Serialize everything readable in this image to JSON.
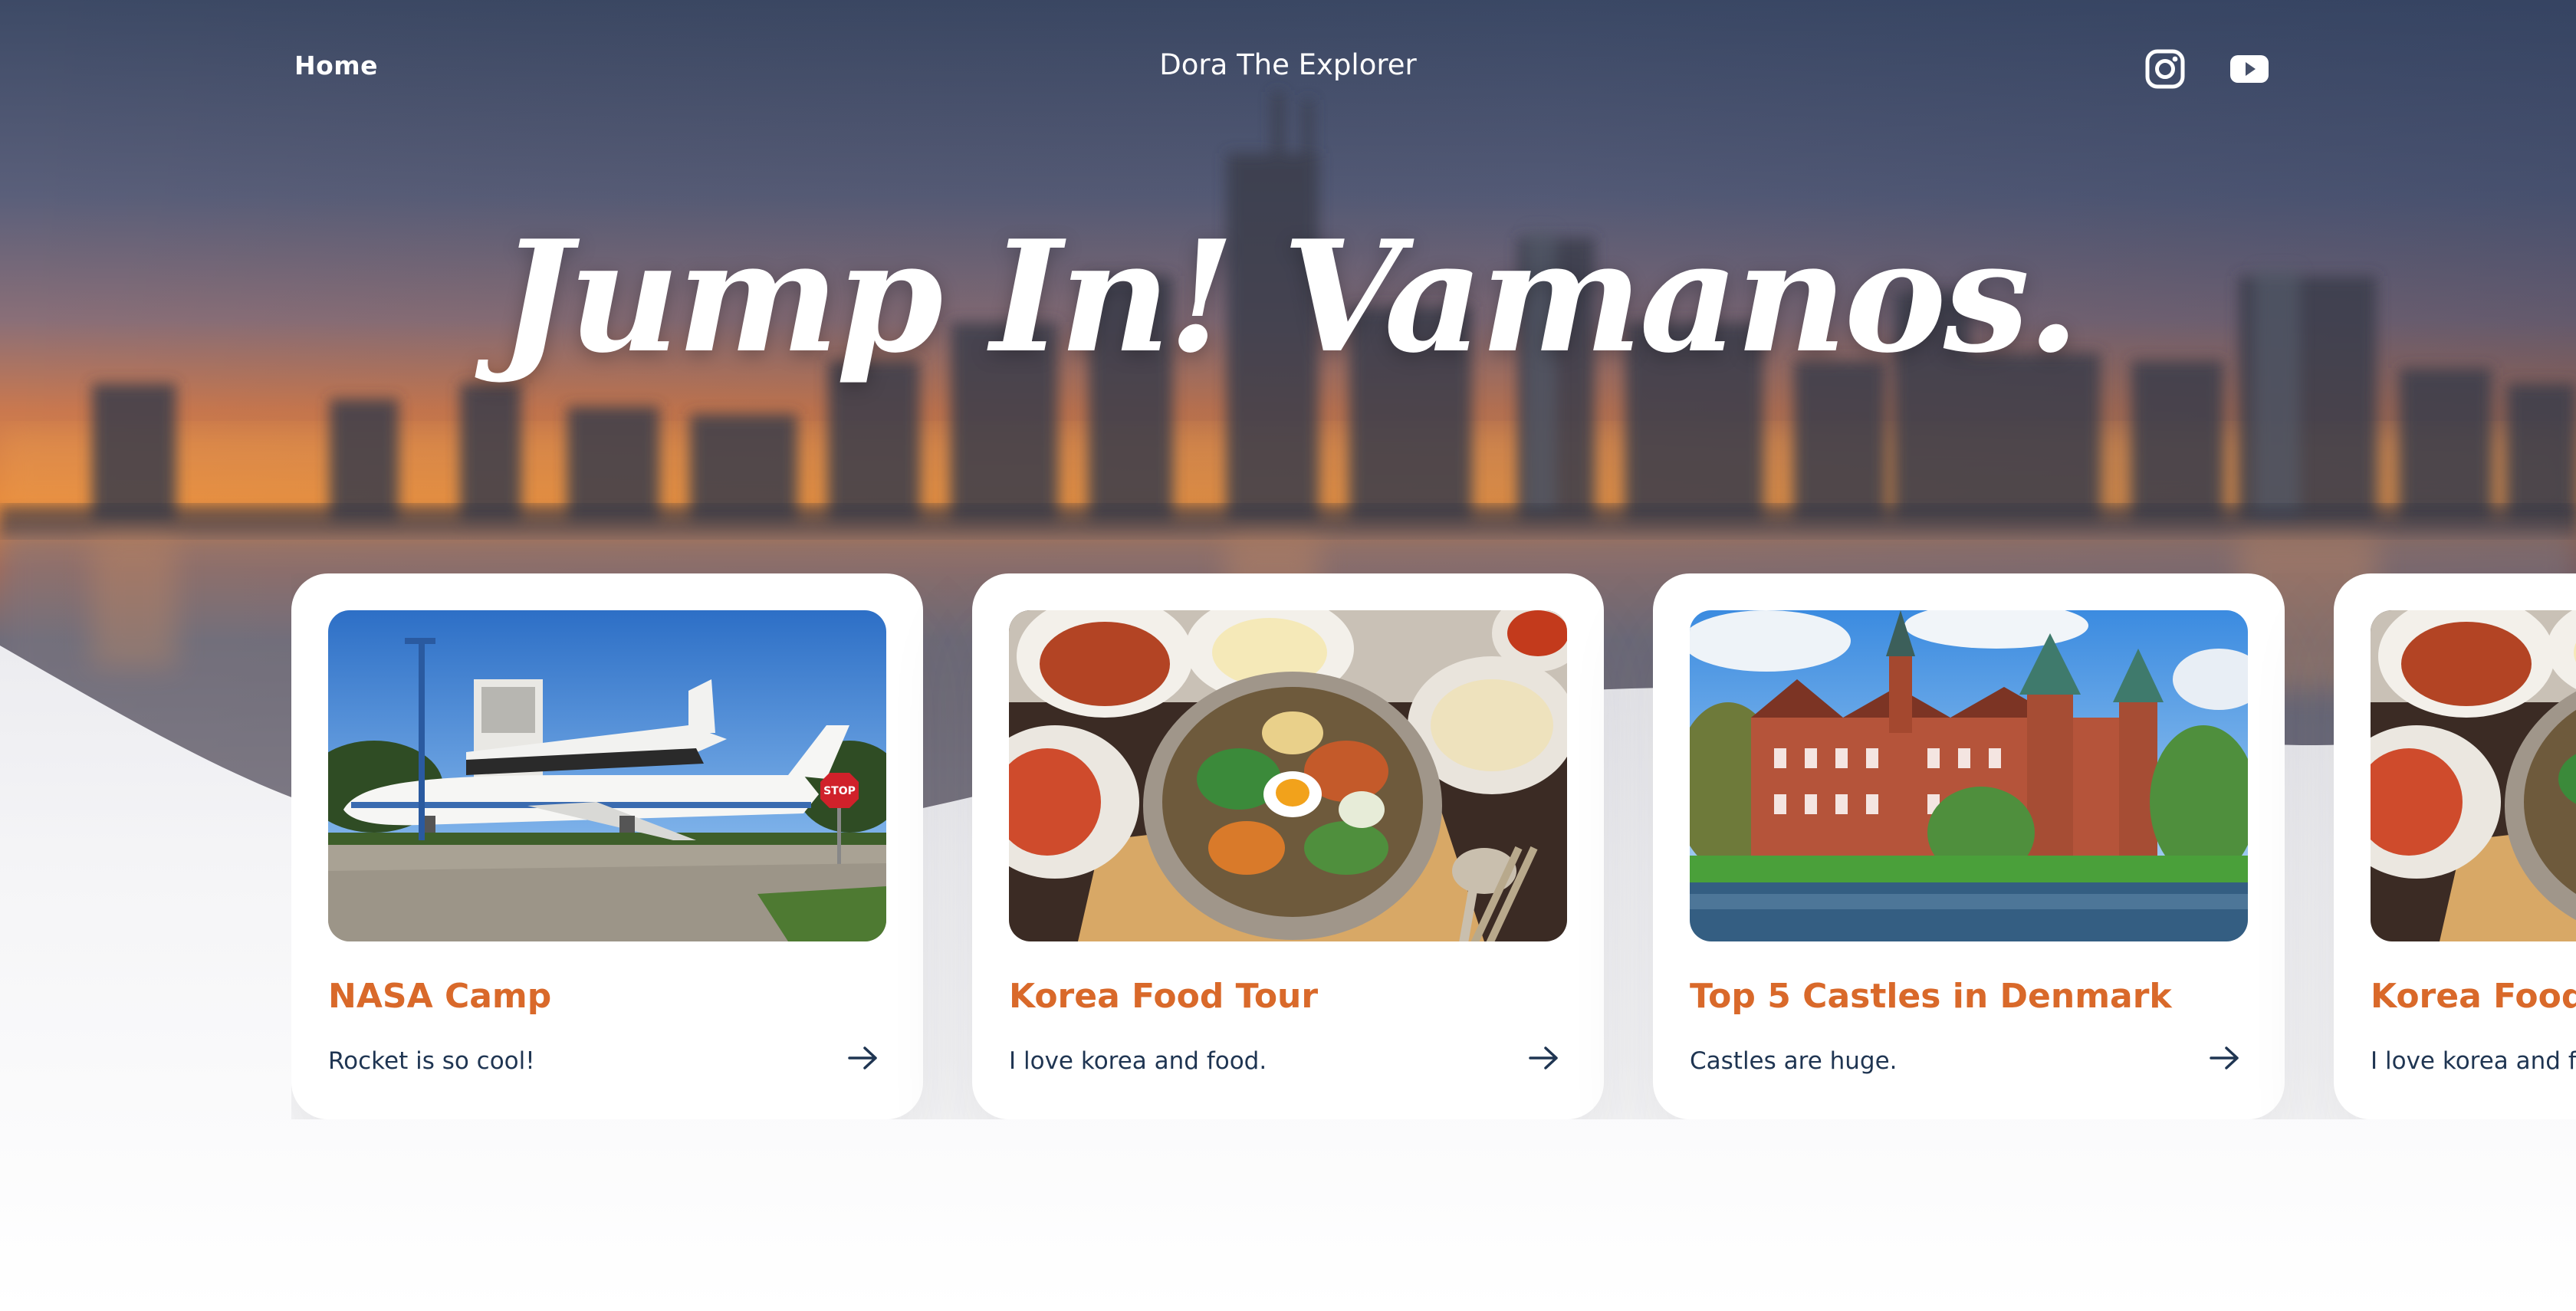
{
  "nav": {
    "home_label": "Home",
    "brand": "Dora The Explorer",
    "social": [
      {
        "icon": "instagram-icon"
      },
      {
        "icon": "youtube-icon"
      }
    ]
  },
  "hero": {
    "title": "Jump In! Vamanos."
  },
  "cards": [
    {
      "title": "NASA Camp",
      "description": "Rocket is so cool!",
      "image": "space-shuttle-on-airplane"
    },
    {
      "title": "Korea Food Tour",
      "description": "I love korea and food.",
      "image": "korean-bibimbap-meal"
    },
    {
      "title": "Top 5 Castles in Denmark",
      "description": "Castles are huge.",
      "image": "red-brick-castle-by-lake"
    },
    {
      "title": "Korea Food Tour",
      "description": "I love korea and food.",
      "image": "korean-bibimbap-meal"
    }
  ],
  "colors": {
    "card_title": "#d9692a",
    "card_text": "#1f3552",
    "nav_text": "#ffffff"
  }
}
